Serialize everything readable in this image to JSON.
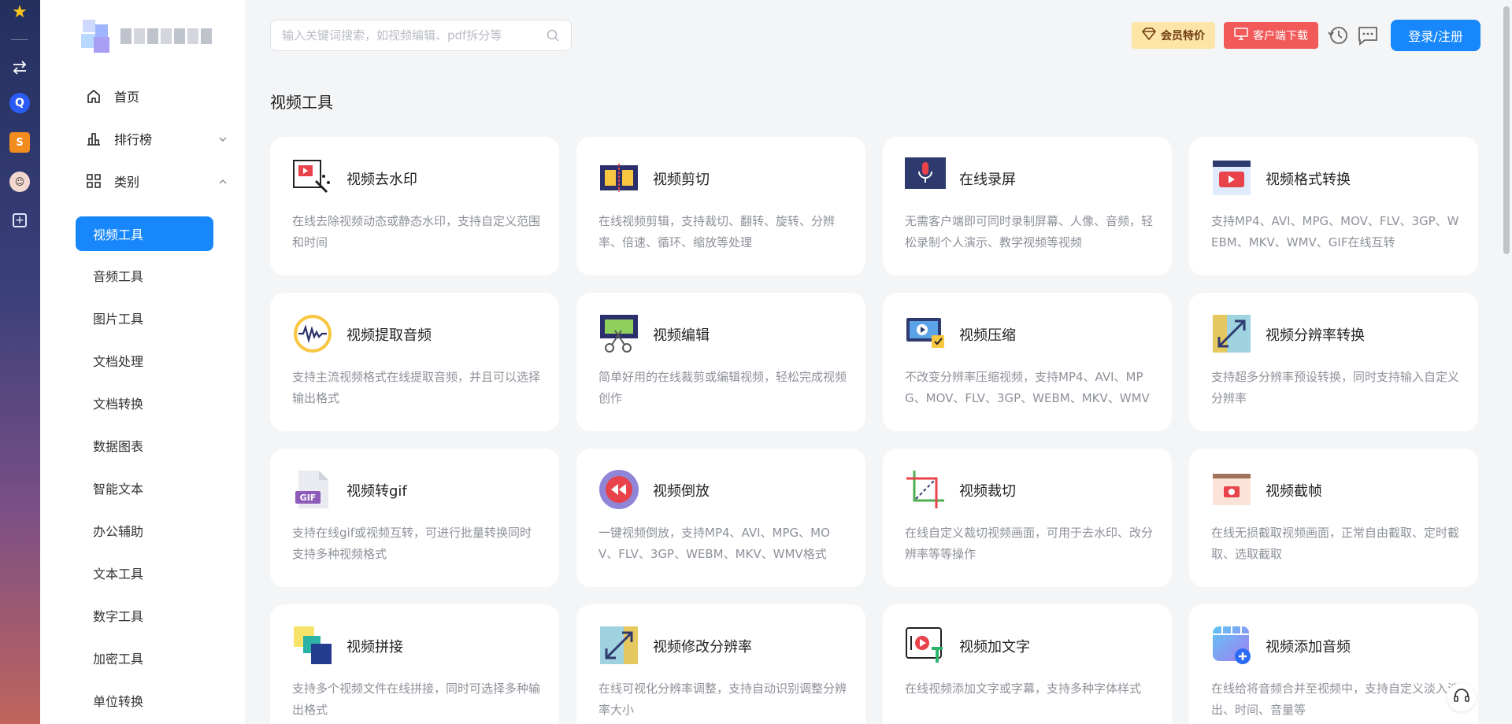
{
  "site": {
    "search_placeholder": "输入关键词搜索，如视频编辑、pdf拆分等"
  },
  "header": {
    "vip_label": "会员特价",
    "client_label": "客户端下载",
    "login_label": "登录/注册"
  },
  "sidebar": {
    "nav": [
      {
        "label": "首页"
      },
      {
        "label": "排行榜"
      },
      {
        "label": "类别"
      }
    ],
    "sub_items": [
      {
        "label": "视频工具",
        "active": true
      },
      {
        "label": "音频工具"
      },
      {
        "label": "图片工具"
      },
      {
        "label": "文档处理"
      },
      {
        "label": "文档转换"
      },
      {
        "label": "数据图表"
      },
      {
        "label": "智能文本"
      },
      {
        "label": "办公辅助"
      },
      {
        "label": "文本工具"
      },
      {
        "label": "数字工具"
      },
      {
        "label": "加密工具"
      },
      {
        "label": "单位转换"
      }
    ]
  },
  "main": {
    "section_title": "视频工具",
    "cards": [
      {
        "title": "视频去水印",
        "desc": "在线去除视频动态或静态水印，支持自定义范围和时间",
        "icon": "watermark-remove-icon"
      },
      {
        "title": "视频剪切",
        "desc": "在线视频剪辑，支持裁切、翻转、旋转、分辨率、倍速、循环、缩放等处理",
        "icon": "film-cut-icon"
      },
      {
        "title": "在线录屏",
        "desc": "无需客户端即可同时录制屏幕、人像、音频，轻松录制个人演示、教学视频等视频",
        "icon": "screen-record-icon"
      },
      {
        "title": "视频格式转换",
        "desc": "支持MP4、AVI、MPG、MOV、FLV、3GP、WEBM、MKV、WMV、GIF在线互转",
        "icon": "video-convert-icon"
      },
      {
        "title": "视频提取音频",
        "desc": "支持主流视频格式在线提取音频，并且可以选择输出格式",
        "icon": "audio-wave-icon"
      },
      {
        "title": "视频编辑",
        "desc": "简单好用的在线裁剪或编辑视频，轻松完成视频创作",
        "icon": "video-edit-icon"
      },
      {
        "title": "视频压缩",
        "desc": "不改变分辨率压缩视频，支持MP4、AVI、MPG、MOV、FLV、3GP、WEBM、MKV、WMV",
        "icon": "video-compress-icon"
      },
      {
        "title": "视频分辨率转换",
        "desc": "支持超多分辨率预设转换，同时支持输入自定义分辨率",
        "icon": "resolution-icon"
      },
      {
        "title": "视频转gif",
        "desc": "支持在线gif或视频互转，可进行批量转换同时支持多种视频格式",
        "icon": "gif-file-icon"
      },
      {
        "title": "视频倒放",
        "desc": "一键视频倒放，支持MP4、AVI、MPG、MOV、FLV、3GP、WEBM、MKV、WMV格式",
        "icon": "rewind-icon"
      },
      {
        "title": "视频裁切",
        "desc": "在线自定义裁切视频画面，可用于去水印、改分辨率等等操作",
        "icon": "crop-icon"
      },
      {
        "title": "视频截帧",
        "desc": "在线无损截取视频画面，正常自由截取、定时截取、选取截取",
        "icon": "frame-capture-icon"
      },
      {
        "title": "视频拼接",
        "desc": "支持多个视频文件在线拼接，同时可选择多种输出格式",
        "icon": "video-merge-icon"
      },
      {
        "title": "视频修改分辨率",
        "desc": "在线可视化分辨率调整，支持自动识别调整分辨率大小",
        "icon": "resize-icon"
      },
      {
        "title": "视频加文字",
        "desc": "在线视频添加文字或字幕，支持多种字体样式",
        "icon": "add-text-icon"
      },
      {
        "title": "视频添加音频",
        "desc": "在线给将音频合并至视频中，支持自定义淡入淡出、时间、音量等",
        "icon": "add-audio-icon"
      }
    ]
  },
  "colors": {
    "primary": "#1787fb",
    "vip_bg": "#fde4a7",
    "client_bg": "#f25a5a"
  }
}
